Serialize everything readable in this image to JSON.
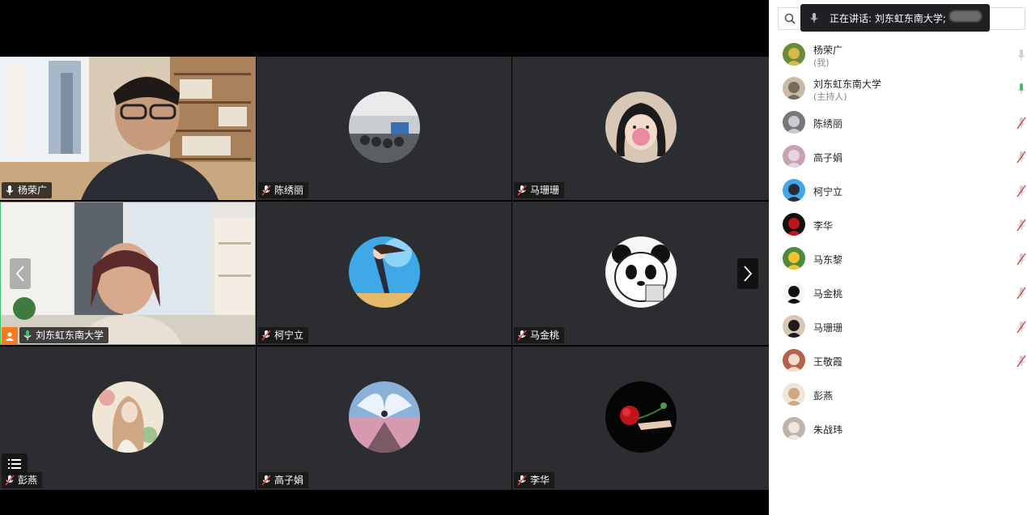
{
  "speaking": {
    "label": "正在讲话: 刘东虹东南大学;"
  },
  "search": {
    "placeholder": ""
  },
  "tiles": [
    {
      "name": "杨荣广",
      "mic": "on"
    },
    {
      "name": "陈绣丽",
      "mic": "muted"
    },
    {
      "name": "马珊珊",
      "mic": "muted"
    },
    {
      "name": "刘东虹东南大学",
      "mic": "active"
    },
    {
      "name": "柯宁立",
      "mic": "muted"
    },
    {
      "name": "马金桃",
      "mic": "muted"
    },
    {
      "name": "彭燕",
      "mic": "muted"
    },
    {
      "name": "高子娟",
      "mic": "muted"
    },
    {
      "name": "李华",
      "mic": "muted"
    }
  ],
  "participants": [
    {
      "name": "杨荣广",
      "role": "(我)",
      "mic": "on"
    },
    {
      "name": "刘东虹东南大学",
      "role": "(主持人)",
      "mic": "active"
    },
    {
      "name": "陈绣丽",
      "role": "",
      "mic": "muted"
    },
    {
      "name": "高子娟",
      "role": "",
      "mic": "muted"
    },
    {
      "name": "柯宁立",
      "role": "",
      "mic": "muted"
    },
    {
      "name": "李华",
      "role": "",
      "mic": "muted"
    },
    {
      "name": "马东黎",
      "role": "",
      "mic": "muted"
    },
    {
      "name": "马金桃",
      "role": "",
      "mic": "muted"
    },
    {
      "name": "马珊珊",
      "role": "",
      "mic": "muted"
    },
    {
      "name": "王敬霞",
      "role": "",
      "mic": "muted"
    },
    {
      "name": "彭燕",
      "role": "",
      "mic": "none"
    },
    {
      "name": "朱战玮",
      "role": "",
      "mic": "none"
    }
  ],
  "colors": {
    "accent_green": "#3fbf6a",
    "host_orange": "#f37b22",
    "muted_red": "#e04040",
    "tile_bg": "#2b2d30"
  },
  "icons": {
    "search": "search-icon",
    "mic": "mic-icon",
    "mic_muted": "mic-muted-icon",
    "prev": "chevron-left-icon",
    "next": "chevron-right-icon",
    "list": "list-icon",
    "host": "person-icon"
  }
}
